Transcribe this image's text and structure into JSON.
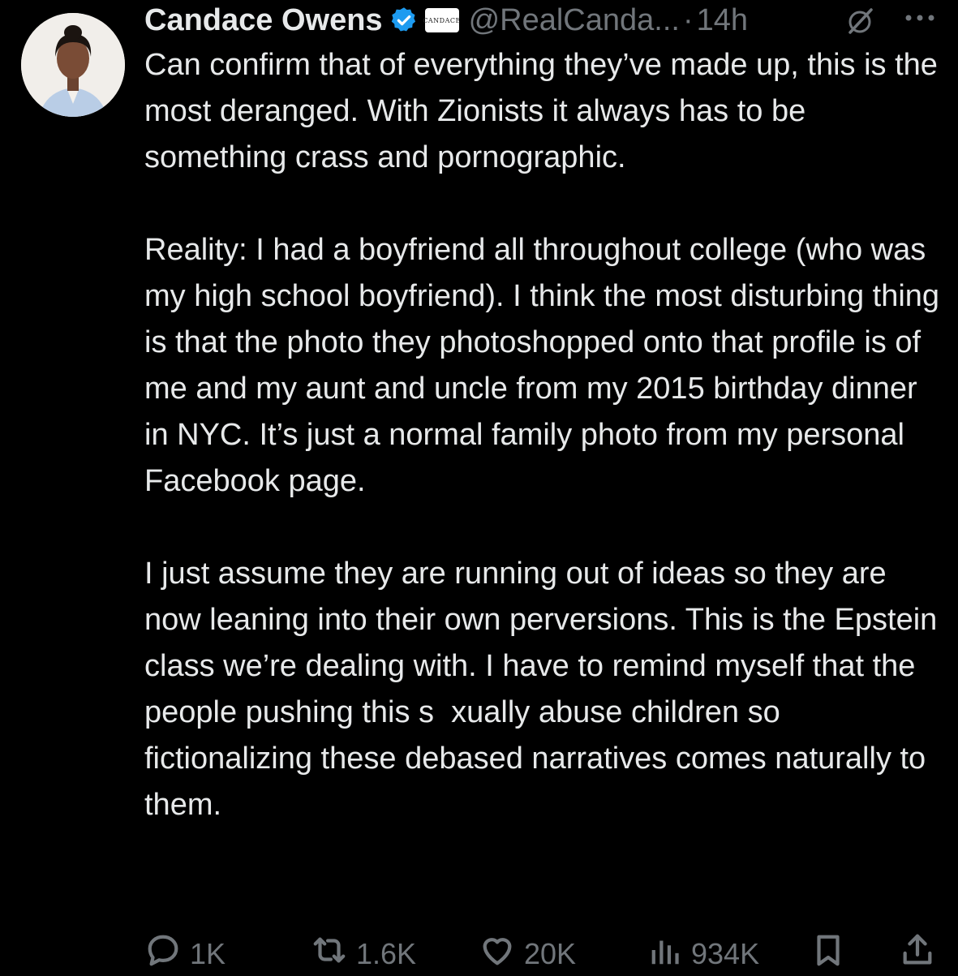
{
  "author": {
    "name": "Candace Owens",
    "affiliate_badge": "CANDACE",
    "handle": "@RealCanda...",
    "separator": "·",
    "time": "14h"
  },
  "tweet": {
    "paragraphs": [
      "Can confirm that of everything they’ve made up, this is the most deranged. With Zionists it always has to be something crass and pornographic.",
      "Reality: I had a boyfriend all throughout college (who was my high school boyfriend). I think the most disturbing thing is that the photo they photoshopped onto that profile is of me and my aunt and uncle from my 2015 birthday dinner in NYC. It’s just a normal family photo from my personal Facebook page.",
      "I just assume they are running out of ideas so they are now leaning into their own perversions. This is the Epstein class we’re dealing with. I have to remind myself that the people pushing this s  xually abuse children so fictionalizing these debased narratives comes naturally to them."
    ]
  },
  "metrics": {
    "replies": "1K",
    "reposts": "1.6K",
    "likes": "20K",
    "views": "934K"
  },
  "icons": {
    "verified": "verified-badge-icon",
    "grok": "grok-icon",
    "more": "more-icon",
    "reply": "reply-icon",
    "repost": "repost-icon",
    "like": "heart-icon",
    "views": "views-icon",
    "bookmark": "bookmark-icon",
    "share": "share-icon"
  },
  "colors": {
    "background": "#000000",
    "text": "#e7e9ea",
    "secondary": "#71767b",
    "verified": "#1d9bf0"
  }
}
